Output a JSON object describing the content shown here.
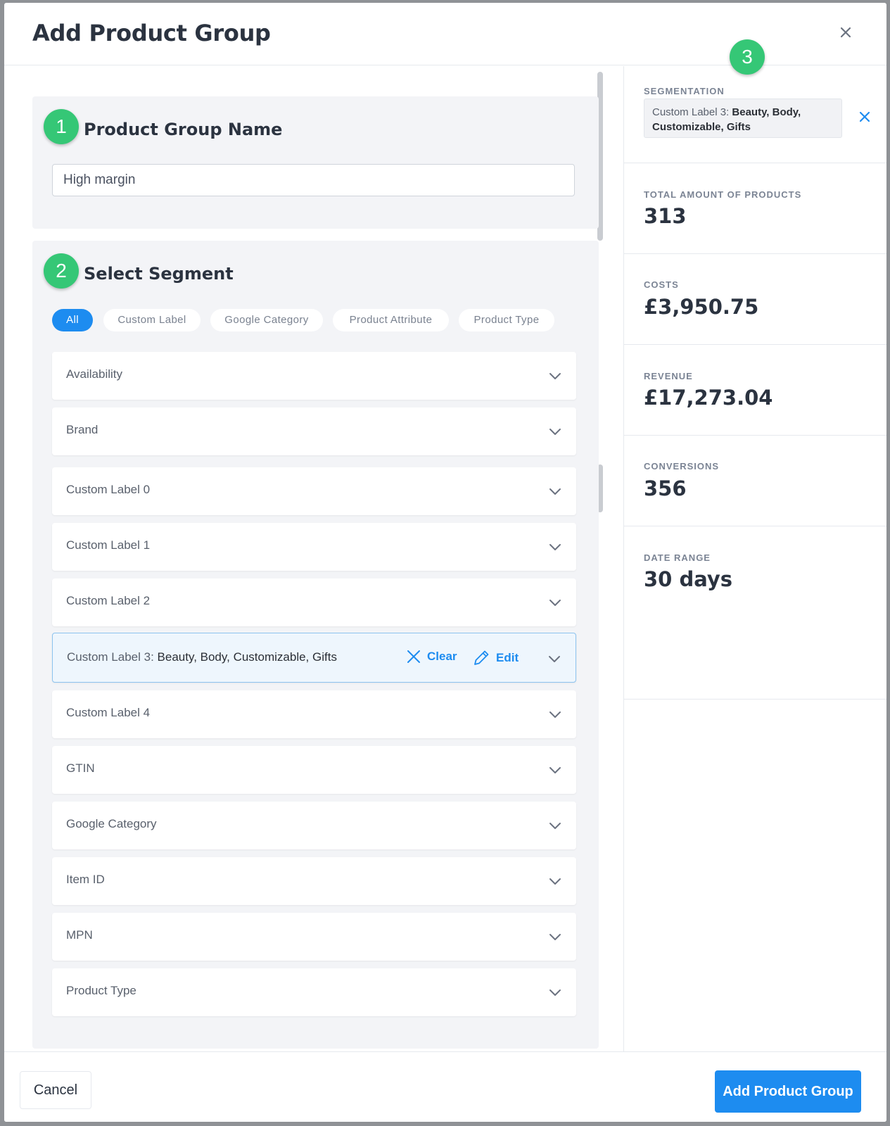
{
  "modal": {
    "title": "Add Product Group",
    "close_icon": "close-icon"
  },
  "step1": {
    "badge": "1",
    "title": "Product Group Name",
    "input_value": "High margin"
  },
  "step2": {
    "badge": "2",
    "title": "Select Segment",
    "filters": [
      "All",
      "Custom Label",
      "Google Category",
      "Product Attribute",
      "Product Type"
    ],
    "active_filter": "All",
    "rows": [
      {
        "label": "Availability"
      },
      {
        "label": "Brand"
      },
      {
        "label": "Custom Label 0"
      },
      {
        "label": "Custom Label 1"
      },
      {
        "label": "Custom Label 2"
      },
      {
        "label": "Custom Label 3:",
        "value": "Beauty, Body, Customizable, Gifts",
        "selected": true
      },
      {
        "label": "Custom Label 4"
      },
      {
        "label": "GTIN"
      },
      {
        "label": "Google Category"
      },
      {
        "label": "Item ID"
      },
      {
        "label": "MPN"
      },
      {
        "label": "Product Type"
      }
    ],
    "clear_label": "Clear",
    "edit_label": "Edit"
  },
  "step3": {
    "badge": "3",
    "segmentation_label": "SEGMENTATION",
    "segmentation_key": "Custom Label 3:",
    "segmentation_value": "Beauty, Body, Customizable, Gifts",
    "stats": [
      {
        "label": "TOTAL AMOUNT OF PRODUCTS",
        "value": "313"
      },
      {
        "label": "COSTS",
        "value": "£3,950.75"
      },
      {
        "label": "REVENUE",
        "value": "£17,273.04"
      },
      {
        "label": "CONVERSIONS",
        "value": "356"
      },
      {
        "label": "DATE RANGE",
        "value": "30 days"
      }
    ]
  },
  "footer": {
    "cancel_label": "Cancel",
    "submit_label": "Add Product Group"
  },
  "colors": {
    "accent": "#1d8cf0",
    "badge_green": "#35c776"
  }
}
